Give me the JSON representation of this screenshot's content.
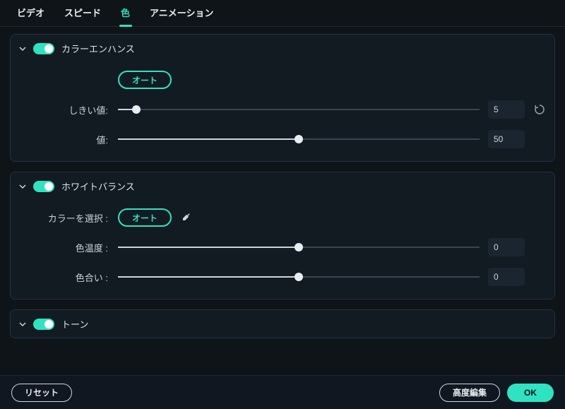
{
  "tabs": {
    "video": "ビデオ",
    "speed": "スピード",
    "color": "色",
    "animation": "アニメーション"
  },
  "sections": {
    "color_enhance": {
      "title": "カラーエンハンス",
      "auto_label": "オート",
      "threshold": {
        "label": "しきい値:",
        "value": "5",
        "percent": 5
      },
      "value_row": {
        "label": "値:",
        "value": "50",
        "percent": 50
      }
    },
    "white_balance": {
      "title": "ホワイトバランス",
      "picker_label": "カラーを選択 :",
      "auto_label": "オート",
      "temperature": {
        "label": "色温度 :",
        "value": "0",
        "percent": 50
      },
      "tint": {
        "label": "色合い :",
        "value": "0",
        "percent": 50
      }
    },
    "tone": {
      "title": "トーン"
    }
  },
  "footer": {
    "reset": "リセット",
    "advanced": "高度編集",
    "ok": "OK"
  }
}
